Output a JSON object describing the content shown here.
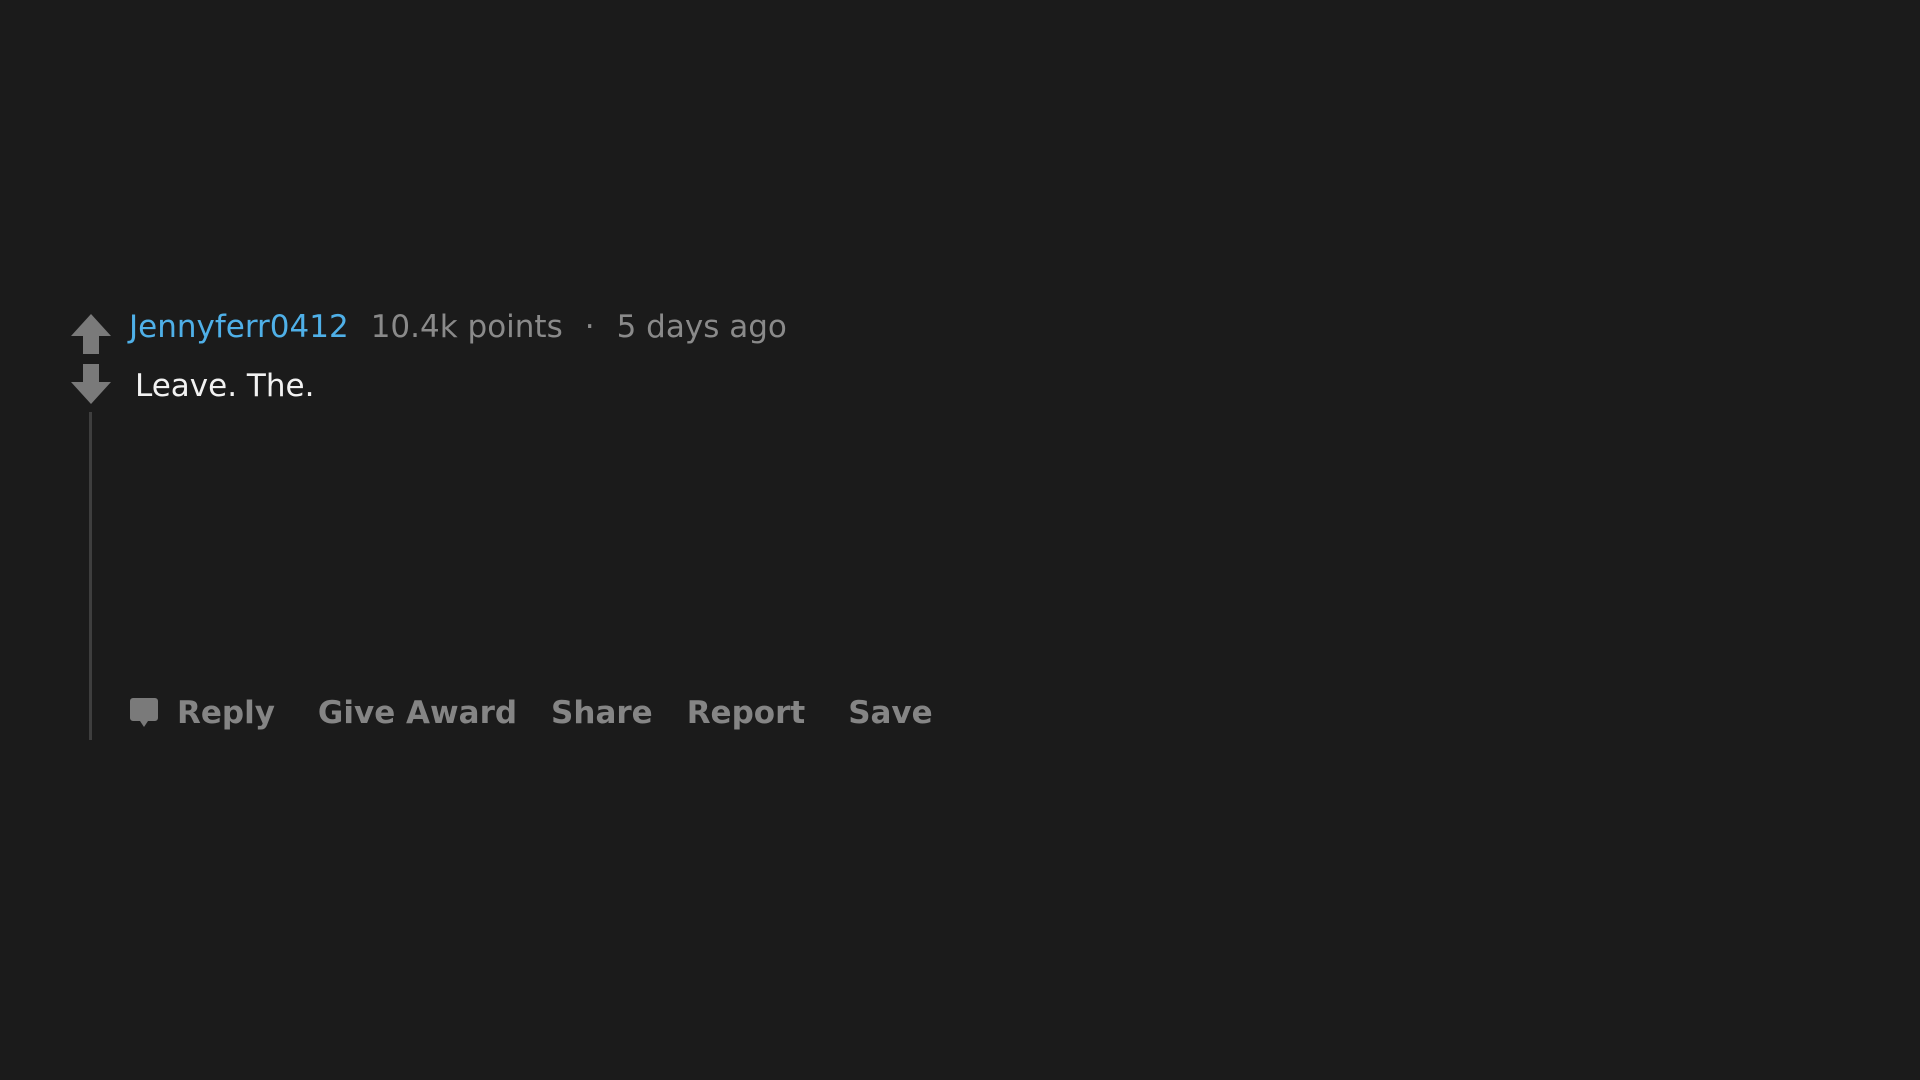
{
  "comment": {
    "author": "Jennyferr0412",
    "points": "10.4k points",
    "separator": "·",
    "time": "5 days ago",
    "body": "Leave. The."
  },
  "actions": {
    "reply": "Reply",
    "give_award": "Give Award",
    "share": "Share",
    "report": "Report",
    "save": "Save"
  },
  "icons": {
    "upvote": "arrow-up-icon",
    "downvote": "arrow-down-icon",
    "reply": "speech-bubble-icon"
  },
  "colors": {
    "background": "#1b1b1b",
    "author": "#4fb0e8",
    "meta_text": "#8a8a8a",
    "body_text": "#f2f2f2",
    "action_text": "#858585",
    "vote_arrow": "#7a7a7a",
    "thread_line": "#3e3e3e"
  }
}
